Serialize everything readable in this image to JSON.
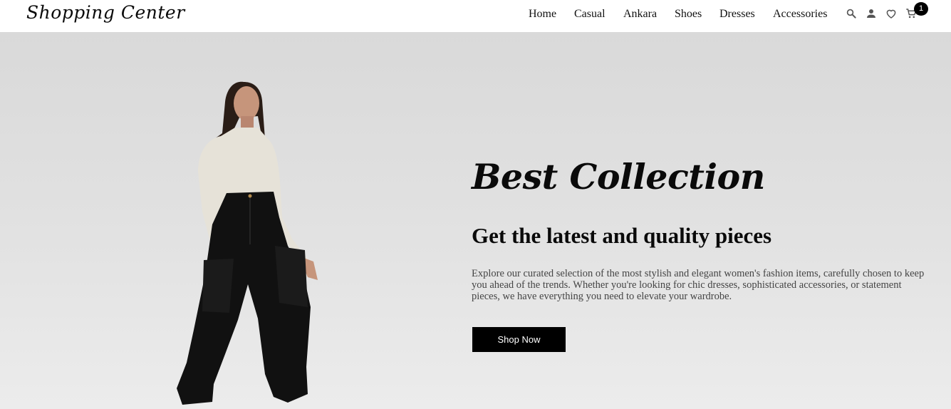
{
  "header": {
    "brand": "Shopping Center",
    "nav": [
      "Home",
      "Casual",
      "Ankara",
      "Shoes",
      "Dresses",
      "Accessories"
    ],
    "icons": [
      "search-icon",
      "user-icon",
      "heart-icon",
      "cart-icon"
    ],
    "cart_count": "1"
  },
  "hero": {
    "script_title": "Best Collection",
    "headline": "Get the latest and quality pieces",
    "description": "Explore our curated selection of the most stylish and elegant women's fashion items, carefully chosen to keep you ahead of the trends. Whether you're looking for chic dresses, sophisticated accessories, or statement pieces, we have everything you need to elevate your wardrobe.",
    "cta_label": "Shop Now"
  },
  "colors": {
    "header_bg": "#ffffff",
    "hero_bg": "#dcdcdc",
    "button_bg": "#000000",
    "button_text": "#ffffff",
    "text_primary": "#0a0a0a",
    "text_muted": "#444444"
  }
}
